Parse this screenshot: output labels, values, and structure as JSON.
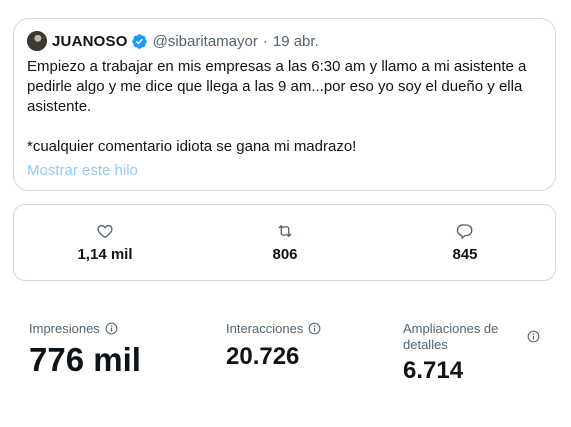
{
  "tweet": {
    "author_name": "JUANOSO",
    "handle": "@sibaritamayor",
    "separator": "·",
    "date": "19 abr.",
    "text": "Empiezo a trabajar en mis empresas a las 6:30 am y llamo a mi asistente a pedirle algo y me dice que llega a las 9 am...por eso yo soy el dueño y ella asistente.\n\n*cualquier comentario idiota se gana mi madrazo!",
    "show_thread": "Mostrar este hilo",
    "verified_icon": "verified-badge-icon",
    "colors": {
      "verified": "#1d9bf0",
      "link": "#8ecdf8",
      "secondary": "#536471",
      "border": "#cfd9de"
    }
  },
  "engagement": {
    "likes": {
      "icon": "heart-icon",
      "value": "1,14 mil"
    },
    "retweets": {
      "icon": "retweet-icon",
      "value": "806"
    },
    "replies": {
      "icon": "reply-icon",
      "value": "845"
    }
  },
  "stats": {
    "impressions": {
      "label": "Impresiones",
      "value": "776 mil",
      "icon": "info-icon"
    },
    "engagements": {
      "label": "Interacciones",
      "value": "20.726",
      "icon": "info-icon"
    },
    "detail_expands": {
      "label": "Ampliaciones de detalles",
      "value": "6.714",
      "icon": "info-icon"
    }
  }
}
